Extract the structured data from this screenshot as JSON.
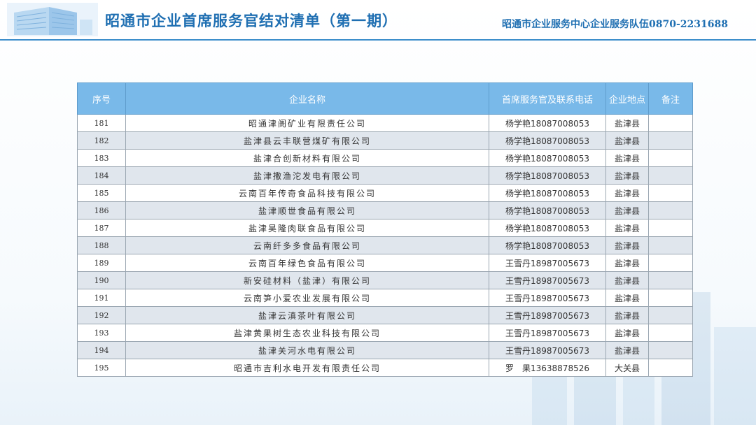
{
  "header": {
    "title": "昭通市企业首席服务官结对清单（第一期）",
    "contact": "昭通市企业服务中心企业服务队伍0870-2231688"
  },
  "table": {
    "columns": [
      "序号",
      "企业名称",
      "首席服务官及联系电话",
      "企业地点",
      "备注"
    ],
    "rows": [
      [
        "181",
        "昭通津阓矿业有限责任公司",
        "杨学艳18087008053",
        "盐津县",
        ""
      ],
      [
        "182",
        "盐津县云丰联营煤矿有限公司",
        "杨学艳18087008053",
        "盐津县",
        ""
      ],
      [
        "183",
        "盐津合创新材料有限公司",
        "杨学艳18087008053",
        "盐津县",
        ""
      ],
      [
        "184",
        "盐津撒渔沱发电有限公司",
        "杨学艳18087008053",
        "盐津县",
        ""
      ],
      [
        "185",
        "云南百年传奇食品科技有限公司",
        "杨学艳18087008053",
        "盐津县",
        ""
      ],
      [
        "186",
        "盐津顺世食品有限公司",
        "杨学艳18087008053",
        "盐津县",
        ""
      ],
      [
        "187",
        "盐津昊隆肉联食品有限公司",
        "杨学艳18087008053",
        "盐津县",
        ""
      ],
      [
        "188",
        "云南纤多多食品有限公司",
        "杨学艳18087008053",
        "盐津县",
        ""
      ],
      [
        "189",
        "云南百年绿色食品有限公司",
        "王雪丹18987005673",
        "盐津县",
        ""
      ],
      [
        "190",
        "新安硅材料（盐津）有限公司",
        "王雪丹18987005673",
        "盐津县",
        ""
      ],
      [
        "191",
        "云南笋小爱农业发展有限公司",
        "王雪丹18987005673",
        "盐津县",
        ""
      ],
      [
        "192",
        "盐津云滇茶叶有限公司",
        "王雪丹18987005673",
        "盐津县",
        ""
      ],
      [
        "193",
        "盐津黄果树生态农业科技有限公司",
        "王雪丹18987005673",
        "盐津县",
        ""
      ],
      [
        "194",
        "盐津关河水电有限公司",
        "王雪丹18987005673",
        "盐津县",
        ""
      ],
      [
        "195",
        "昭通市吉利水电开发有限责任公司",
        "罗　果13638878526",
        "大关县",
        ""
      ]
    ]
  }
}
